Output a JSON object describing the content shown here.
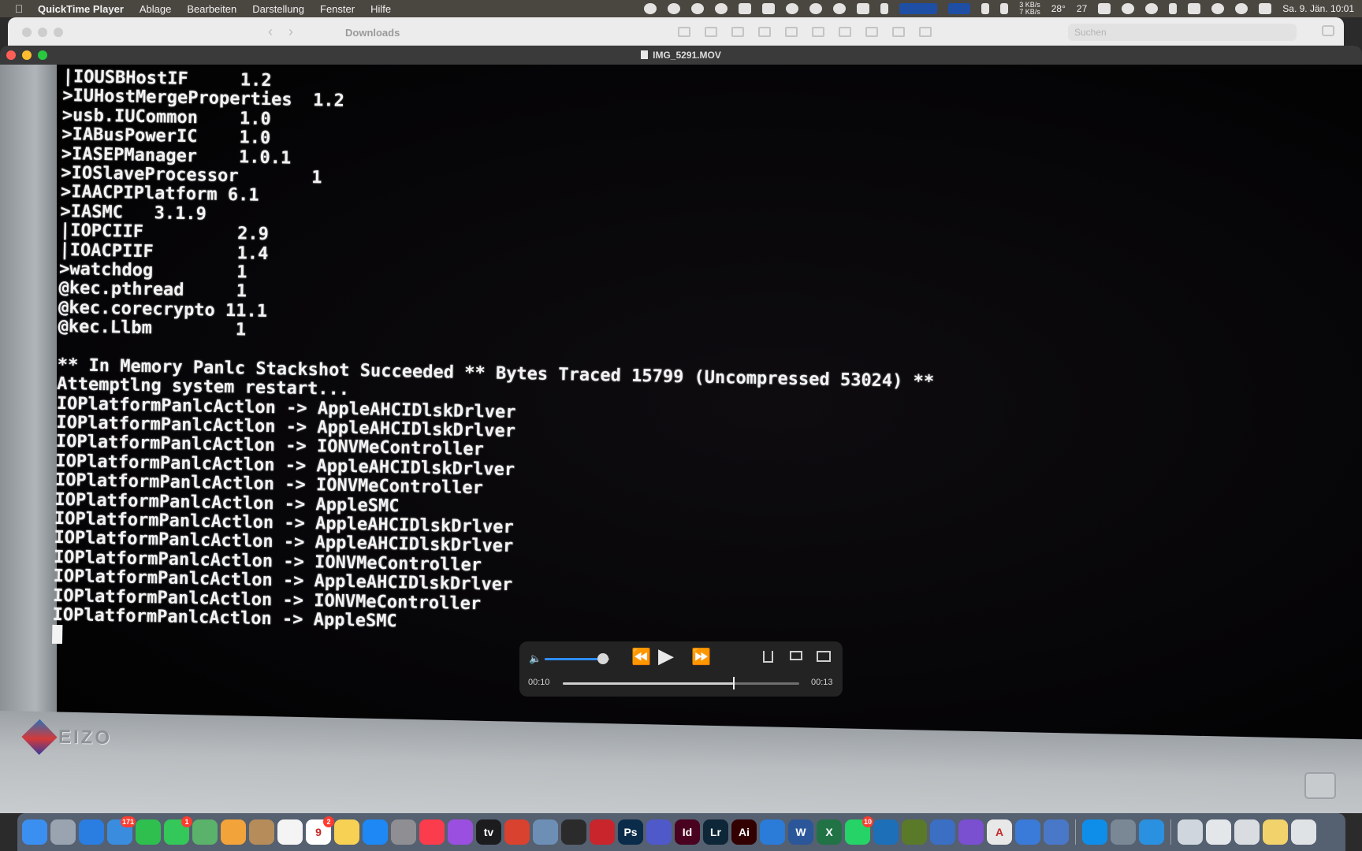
{
  "menubar": {
    "app_name": "QuickTime Player",
    "menus": [
      "Ablage",
      "Bearbeiten",
      "Darstellung",
      "Fenster",
      "Hilfe"
    ],
    "network_up": "3 KB/s",
    "network_down": "7 KB/s",
    "temperature": "28°",
    "counter": "27",
    "datetime": "Sa. 9. Jän. 10:01"
  },
  "finder": {
    "title": "Downloads",
    "search_placeholder": "Suchen"
  },
  "player": {
    "window_title": "IMG_5291.MOV",
    "elapsed": "00:10",
    "remaining": "00:13",
    "volume_level": 0.9,
    "progress": 0.72
  },
  "monitor": {
    "brand": "EIZO"
  },
  "terminal": {
    "module_lines": [
      "|IOUSBHostIF     1.2",
      ">IUHostMergeProperties  1.2",
      ">usb.IUCommon    1.0",
      ">IABusPowerIC    1.0",
      ">IASEPManager    1.0.1",
      ">IOSlaveProcessor       1",
      ">IAACPIPlatform 6.1",
      ">IASMC   3.1.9",
      "|IOPCIIF         2.9",
      "|IOACPIIF        1.4",
      ">watchdog        1",
      "@kec.pthread     1",
      "@kec.corecrypto 11.1",
      "@kec.Llbm        1"
    ],
    "panic_lines": [
      "** In Memory Panlc Stackshot Succeeded ** Bytes Traced 15799 (Uncompressed 53024) **",
      "Attemptlng system restart...",
      "IOPlatformPanlcActlon -> AppleAHCIDlskDrlver",
      "IOPlatformPanlcActlon -> AppleAHCIDlskDrlver",
      "IOPlatformPanlcActlon -> IONVMeController",
      "IOPlatformPanlcActlon -> AppleAHCIDlskDrlver",
      "IOPlatformPanlcActlon -> IONVMeController",
      "IOPlatformPanlcActlon -> AppleSMC",
      "IOPlatformPanlcActlon -> AppleAHCIDlskDrlver",
      "IOPlatformPanlcActlon -> AppleAHCIDlskDrlver",
      "IOPlatformPanlcActlon -> IONVMeController",
      "IOPlatformPanlcActlon -> AppleAHCIDlskDrlver",
      "IOPlatformPanlcActlon -> IONVMeController",
      "IOPlatformPanlcActlon -> AppleSMC"
    ]
  },
  "dock": {
    "apps": [
      {
        "name": "finder",
        "color": "#3b8ff0",
        "label": ""
      },
      {
        "name": "launchpad",
        "color": "#9aa4b0",
        "label": ""
      },
      {
        "name": "safari",
        "color": "#2a7de1",
        "label": ""
      },
      {
        "name": "mail",
        "color": "#3a8dde",
        "label": "",
        "badge": "171"
      },
      {
        "name": "facetime",
        "color": "#2fbf4f",
        "label": ""
      },
      {
        "name": "messages",
        "color": "#34c759",
        "label": "",
        "badge": "1"
      },
      {
        "name": "maps",
        "color": "#5bb26b",
        "label": ""
      },
      {
        "name": "photos",
        "color": "#f2a33a",
        "label": ""
      },
      {
        "name": "contacts",
        "color": "#b58c5a",
        "label": ""
      },
      {
        "name": "reminders",
        "color": "#f4f4f4",
        "label": ""
      },
      {
        "name": "calendar",
        "color": "#ffffff",
        "label": "9",
        "badge": "2"
      },
      {
        "name": "notes",
        "color": "#f7d154",
        "label": ""
      },
      {
        "name": "app-store",
        "color": "#1e88f5",
        "label": ""
      },
      {
        "name": "system-preferences",
        "color": "#8e8e93",
        "label": ""
      },
      {
        "name": "music",
        "color": "#fa3c4c",
        "label": ""
      },
      {
        "name": "podcasts",
        "color": "#9b4fe0",
        "label": ""
      },
      {
        "name": "apple-tv",
        "color": "#1c1c1e",
        "label": "tv"
      },
      {
        "name": "screens",
        "color": "#d9422f",
        "label": ""
      },
      {
        "name": "preview",
        "color": "#6d8fb5",
        "label": ""
      },
      {
        "name": "final-cut",
        "color": "#2b2b2b",
        "label": ""
      },
      {
        "name": "acrobat",
        "color": "#c9252c",
        "label": ""
      },
      {
        "name": "photoshop",
        "color": "#0b2b4a",
        "label": "Ps"
      },
      {
        "name": "teams",
        "color": "#5059c9",
        "label": ""
      },
      {
        "name": "indesign",
        "color": "#49021f",
        "label": "Id"
      },
      {
        "name": "lightroom",
        "color": "#0d2638",
        "label": "Lr"
      },
      {
        "name": "illustrator",
        "color": "#330000",
        "label": "Ai"
      },
      {
        "name": "vpn",
        "color": "#2b7bd8",
        "label": ""
      },
      {
        "name": "word",
        "color": "#2b579a",
        "label": "W"
      },
      {
        "name": "excel",
        "color": "#217346",
        "label": "X"
      },
      {
        "name": "whatsapp",
        "color": "#25d366",
        "label": "",
        "badge": "10"
      },
      {
        "name": "xcode-tool",
        "color": "#1d6fb8",
        "label": ""
      },
      {
        "name": "globe-tool",
        "color": "#5a7a2a",
        "label": ""
      },
      {
        "name": "scanner",
        "color": "#3a6fc4",
        "label": ""
      },
      {
        "name": "feedback",
        "color": "#7a4fd0",
        "label": ""
      },
      {
        "name": "font-app",
        "color": "#e8e8e8",
        "label": "A"
      },
      {
        "name": "remote-desktop",
        "color": "#3a7ad8",
        "label": ""
      },
      {
        "name": "contacts-add",
        "color": "#4a78c8",
        "label": ""
      }
    ],
    "extras": [
      {
        "name": "teamviewer",
        "color": "#0e8ee9"
      },
      {
        "name": "utility",
        "color": "#7a8896"
      },
      {
        "name": "quicktime",
        "color": "#2a90e0"
      }
    ],
    "stacks": [
      {
        "name": "stack-1",
        "color": "#cfd6de"
      },
      {
        "name": "stack-2",
        "color": "#e4e7ea"
      },
      {
        "name": "stack-3",
        "color": "#d9dde1"
      },
      {
        "name": "stack-4",
        "color": "#f2d26a"
      },
      {
        "name": "trash",
        "color": "#dfe3e6"
      }
    ]
  }
}
